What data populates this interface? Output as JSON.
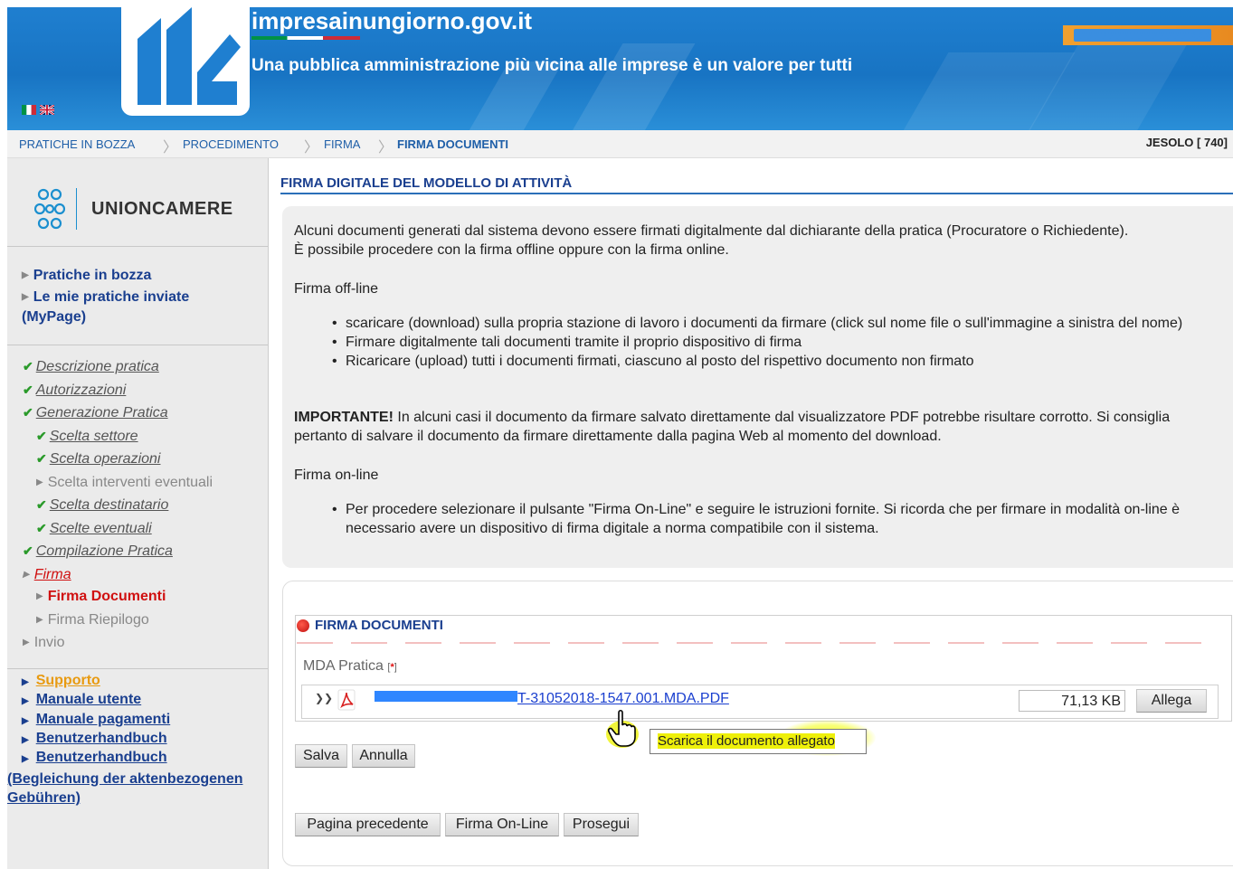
{
  "header": {
    "site_title": "impresainungiorno.gov.it",
    "tagline": "Una pubblica amministrazione più vicina alle imprese è un valore per tutti",
    "languages": [
      "it-flag-icon",
      "uk-flag-icon"
    ]
  },
  "breadcrumb": {
    "items": [
      "PRATICHE IN BOZZA",
      "PROCEDIMENTO",
      "FIRMA",
      "FIRMA DOCUMENTI"
    ],
    "location": "JESOLO [ 740]"
  },
  "sidebar": {
    "logo_text": "UNIONCAMERE",
    "links": [
      "Pratiche in bozza",
      "Le mie pratiche inviate (MyPage)"
    ],
    "steps": {
      "descrizione": "Descrizione pratica",
      "autorizzazioni": "Autorizzazioni",
      "generazione": "Generazione Pratica",
      "scelta_settore": "Scelta settore",
      "scelta_operazioni": "Scelta operazioni",
      "scelta_interventi": "Scelta interventi eventuali",
      "scelta_destinatario": "Scelta destinatario",
      "scelte_eventuali": "Scelte eventuali",
      "compilazione": "Compilazione Pratica",
      "firma": "Firma",
      "firma_documenti": "Firma Documenti",
      "firma_riepilogo": "Firma Riepilogo",
      "invio": "Invio"
    },
    "help": {
      "supporto": "Supporto",
      "manuale_utente": "Manuale utente",
      "manuale_pagamenti": "Manuale pagamenti",
      "benutzerhandbuch_1": "Benutzerhandbuch",
      "benutzerhandbuch_2": "Benutzerhandbuch",
      "benutzerhandbuch_2_suffix": "(Begleichung der aktenbezogenen Gebühren)"
    }
  },
  "main": {
    "section_title": "FIRMA DIGITALE DEL MODELLO DI ATTIVITÀ",
    "intro_1": "Alcuni documenti generati dal sistema devono essere firmati digitalmente dal dichiarante della pratica (Procuratore o Richiedente).",
    "intro_2": "È possibile procedere con la firma offline oppure con la firma online.",
    "offline_title": "Firma off-line",
    "offline_items": [
      "scaricare (download) sulla propria stazione di lavoro i documenti da firmare (click sul nome file o sull'immagine a sinistra del nome)",
      "Firmare digitalmente tali documenti tramite il proprio dispositivo di firma",
      "Ricaricare (upload) tutti i documenti firmati, ciascuno al posto del rispettivo documento non firmato"
    ],
    "important_label": "IMPORTANTE!",
    "important_text": " In alcuni casi il documento da firmare salvato direttamente dal visualizzatore PDF potrebbe risultare corrotto. Si consiglia pertanto di salvare il documento da firmare direttamente dalla pagina Web al momento del download.",
    "online_title": "Firma on-line",
    "online_items": [
      "Per procedere selezionare il pulsante \"Firma On-Line\" e seguire le istruzioni fornite. Si ricorda che per firmare in modalità on-line è necessario avere un dispositivo di firma digitale a norma compatibile con il sistema."
    ]
  },
  "documents": {
    "title": "FIRMA DOCUMENTI",
    "mda_label": "MDA Pratica",
    "required_mark": "*",
    "file_name_visible": "T-31052018-1547.001.MDA.PDF",
    "file_size": "71,13 KB",
    "attach_button": "Allega",
    "tooltip": "Scarica il documento allegato"
  },
  "buttons": {
    "save": "Salva",
    "cancel": "Annulla",
    "previous": "Pagina precedente",
    "sign_online": "Firma On-Line",
    "continue": "Prosegui"
  },
  "colors": {
    "header_blue": "#1874c3",
    "link_blue": "#1a3f8f",
    "active_red": "#d01010",
    "check_green": "#2a9a2a"
  }
}
